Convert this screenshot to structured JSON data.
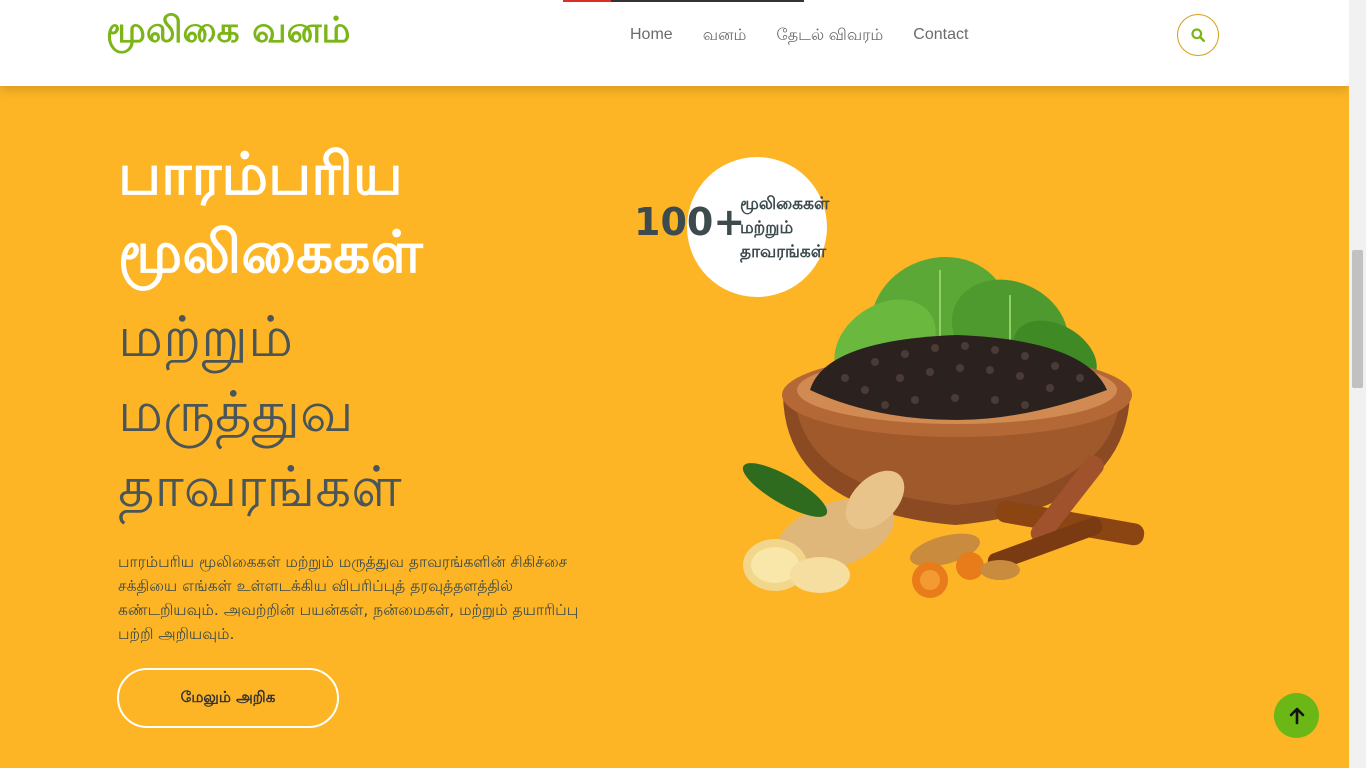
{
  "header": {
    "logo": "மூலிகை வனம்",
    "nav": [
      "Home",
      "வனம்",
      "தேடல் விவரம்",
      "Contact"
    ],
    "search_icon": "search-icon"
  },
  "hero": {
    "title_line1": "பாரம்பரிய",
    "title_line2": "மூலிகைகள்",
    "subtitle_line1": "மற்றும்",
    "subtitle_line2": "மருத்துவ",
    "subtitle_line3": "தாவரங்கள்",
    "description": "பாரம்பரிய மூலிகைகள் மற்றும் மருத்துவ தாவரங்களின் சிகிச்சை சக்தியை எங்கள் உள்ளடக்கிய விபரிப்புத் தரவுத்தளத்தில் கண்டறியவும். அவற்றின் பயன்கள், நன்மைகள், மற்றும் தயாரிப்பு பற்றி அறியவும்.",
    "cta": "மேலும் அறிக",
    "badge_number": "100+",
    "badge_line1": "மூலிகைகள்",
    "badge_line2": "மற்றும்",
    "badge_line3": "தாவரங்கள்"
  },
  "colors": {
    "background": "#fdb526",
    "brand": "#7cb518",
    "to_top": "#6ab715"
  },
  "to_top_icon": "arrow-up-icon"
}
